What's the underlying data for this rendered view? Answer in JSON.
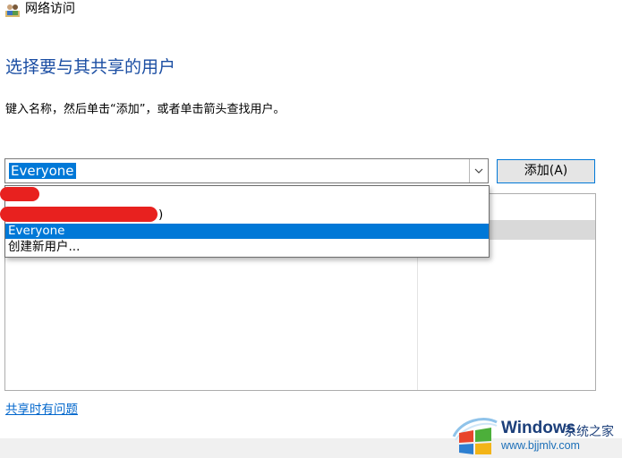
{
  "window": {
    "title": "网络访问",
    "app_icon": "users-share-icon"
  },
  "heading": "选择要与其共享的用户",
  "instruction": "键入名称，然后单击“添加”，或者单击箭头查找用户。",
  "combo": {
    "value": "Everyone",
    "arrow_icon": "chevron-down-icon"
  },
  "add_button": "添加(A)",
  "dropdown": {
    "items": [
      {
        "label": ""
      },
      {
        "label": ")"
      },
      {
        "label": "Everyone",
        "selected": true
      },
      {
        "label": "创建新用户..."
      }
    ]
  },
  "help_link": "共享时有问题",
  "watermark": {
    "title": "Windows",
    "subtitle": "系统之家",
    "url": "www.bjjmlv.com"
  },
  "colors": {
    "accent": "#0078d7",
    "heading": "#1b4ea3",
    "link": "#0066cc",
    "redaction": "#e8211f"
  }
}
